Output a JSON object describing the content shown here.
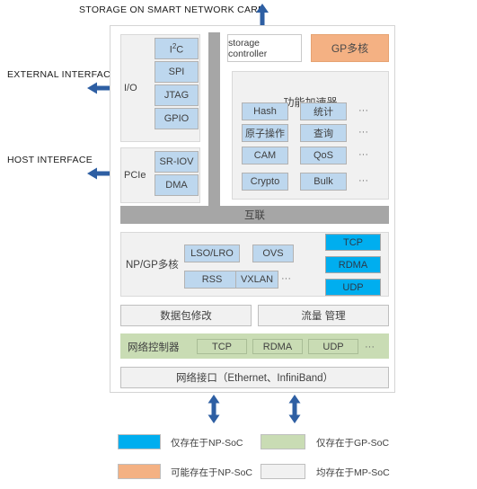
{
  "captions": {
    "top": "STORAGE ON SMART NETWORK CARD",
    "external_interface": "EXTERNAL INTERFACE",
    "host_interface": "HOST INTERFACE"
  },
  "io_block": {
    "label": "I/O",
    "items": [
      "I²C",
      "SPI",
      "JTAG",
      "GPIO"
    ]
  },
  "pcie_block": {
    "label": "PCIe",
    "items": [
      "SR-IOV",
      "DMA"
    ]
  },
  "storage_controller": {
    "label": "storage controller"
  },
  "gp_multicore": {
    "label": "GP多核"
  },
  "accelerator": {
    "title": "功能加速器",
    "rows": [
      {
        "left": "Hash",
        "right": "统计",
        "more": "···"
      },
      {
        "left": "原子操作",
        "right": "查询",
        "more": "···"
      },
      {
        "left": "CAM",
        "right": "QoS",
        "more": "···"
      },
      {
        "left": "Crypto",
        "right": "Bulk",
        "more": "···"
      }
    ]
  },
  "interconnect": {
    "label": "互联"
  },
  "np_gp": {
    "label": "NP/GP多核",
    "row1": [
      "LSO/LRO",
      "OVS"
    ],
    "row2": [
      "RSS",
      "VXLAN"
    ],
    "row2_more": "···",
    "right_stack": [
      "TCP",
      "RDMA",
      "UDP"
    ]
  },
  "mid_rows": {
    "packet_modify": "数据包修改",
    "traffic_manage": "流量 管理"
  },
  "net_controller": {
    "label": "网络控制器",
    "protocols": [
      "TCP",
      "RDMA",
      "UDP"
    ],
    "more": "···"
  },
  "net_interface": {
    "label": "网络接口（Ethernet、InfiniBand）"
  },
  "legend": [
    {
      "color": "#00aeef",
      "border": "#bfbfbf",
      "label": "仅存在于NP-SoC"
    },
    {
      "color": "#c9dcb4",
      "border": "#bfbfbf",
      "label": "仅存在于GP-SoC"
    },
    {
      "color": "#f4b183",
      "border": "#bfbfbf",
      "label": "可能存在于NP-SoC"
    },
    {
      "color": "#f1f1f1",
      "border": "#bfbfbf",
      "label": "均存在于MP-SoC"
    }
  ],
  "colors": {
    "arrow_blue": "#2e5fa3",
    "chip_blue": "#bdd7ee",
    "cyan": "#00aeef",
    "green": "#c9dcb4",
    "orange": "#f4b183",
    "gray_bar": "#a6a6a6",
    "panel_bg": "#f1f1f1"
  }
}
